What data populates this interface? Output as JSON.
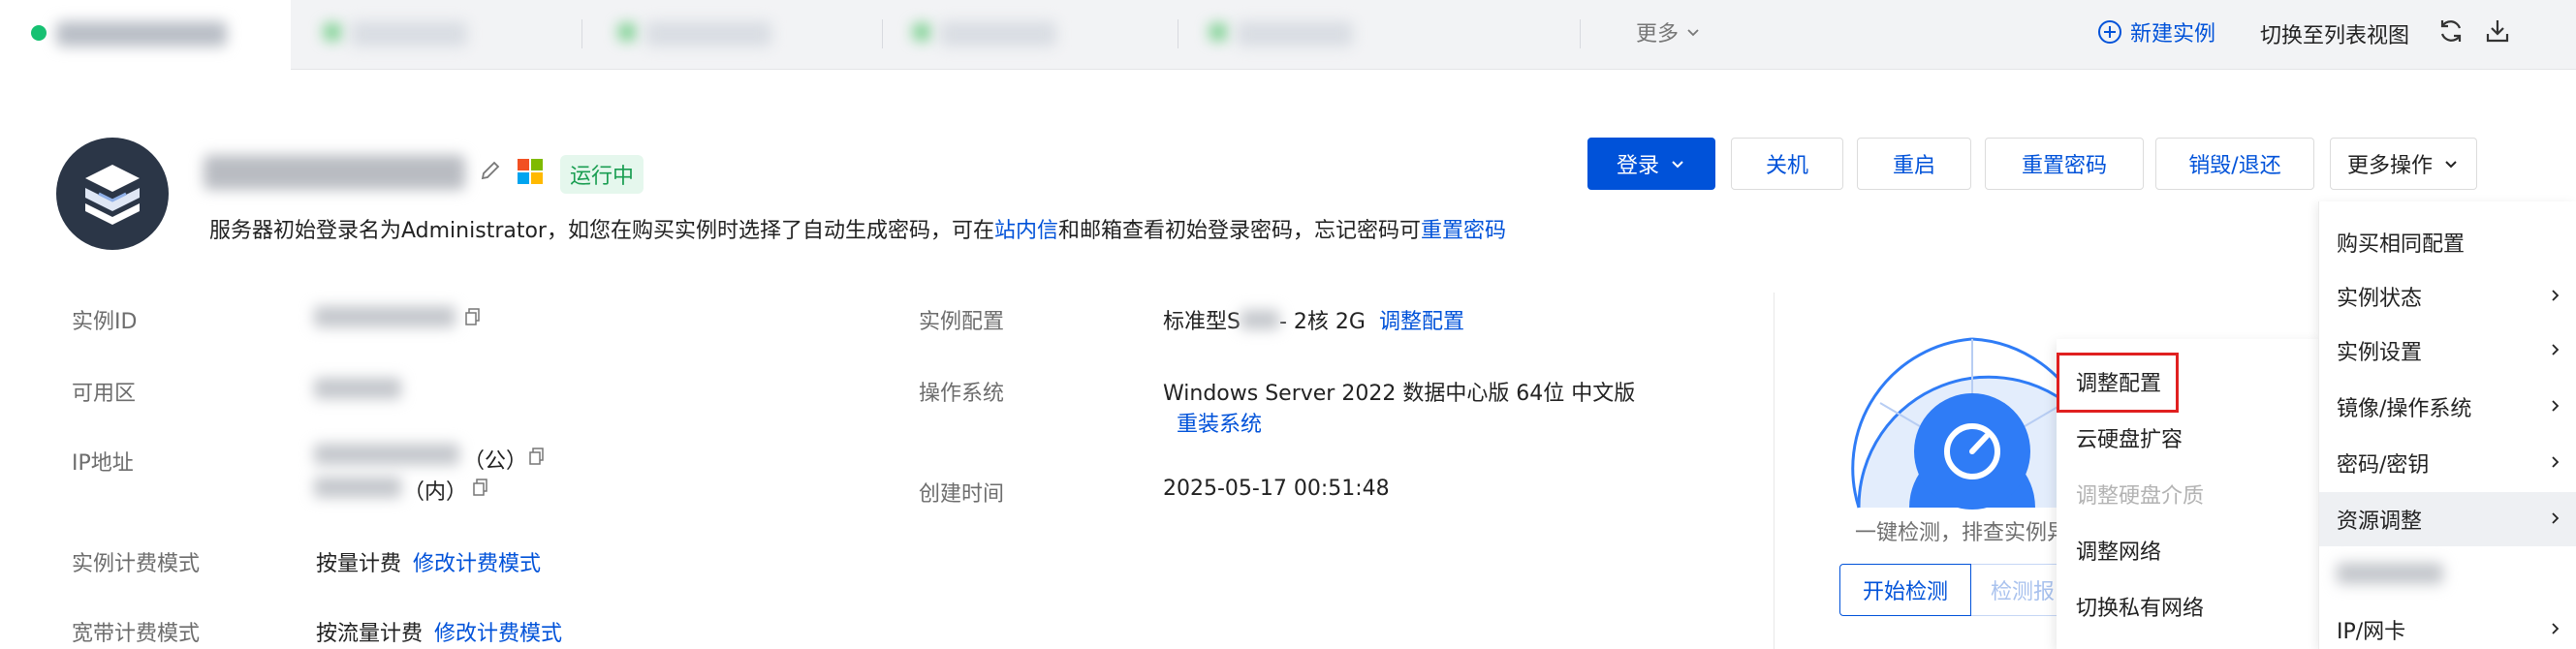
{
  "tabbar": {
    "more_label": "更多",
    "new_instance_label": "新建实例",
    "switch_list_label": "切换至列表视图"
  },
  "instance": {
    "status": "运行中",
    "login_tip_prefix": "服务器初始登录名为Administrator，如您在购买实例时选择了自动生成密码，可在",
    "login_tip_link1": "站内信",
    "login_tip_middle": "和邮箱查看初始登录密码，忘记密码可",
    "login_tip_link2": "重置密码"
  },
  "actions": {
    "login": "登录",
    "shutdown": "关机",
    "restart": "重启",
    "reset_password": "重置密码",
    "destroy": "销毁/退还",
    "more_ops": "更多操作"
  },
  "info": {
    "instance_id_label": "实例ID",
    "zone_label": "可用区",
    "ip_label": "IP地址",
    "ip_public_suffix": "（公）",
    "ip_private_suffix": "（内）",
    "billing_label": "实例计费模式",
    "billing_value": "按量计费",
    "billing_link": "修改计费模式",
    "bandwidth_label": "宽带计费模式",
    "bandwidth_value": "按流量计费",
    "bandwidth_link": "修改计费模式",
    "config_label": "实例配置",
    "config_value_prefix": "标准型S",
    "config_value_suffix": "- 2核 2G",
    "config_link": "调整配置",
    "os_label": "操作系统",
    "os_value": "Windows Server 2022 数据中心版 64位 中文版",
    "os_link": "重装系统",
    "created_label": "创建时间",
    "created_value": "2025-05-17 00:51:48"
  },
  "gauge": {
    "desc": "一键检测，排查实例异",
    "start_btn": "开始检测",
    "report_btn": "检测报"
  },
  "more_menu": {
    "items": [
      {
        "label": "购买相同配置",
        "has_sub": false
      },
      {
        "label": "实例状态",
        "has_sub": true
      },
      {
        "label": "实例设置",
        "has_sub": true
      },
      {
        "label": "镜像/操作系统",
        "has_sub": true
      },
      {
        "label": "密码/密钥",
        "has_sub": true
      },
      {
        "label": "资源调整",
        "has_sub": true,
        "active": true
      },
      {
        "label": "",
        "has_sub": false
      },
      {
        "label": "IP/网卡",
        "has_sub": true
      }
    ]
  },
  "resource_submenu": {
    "items": [
      {
        "label": "调整配置",
        "highlighted": true
      },
      {
        "label": "云硬盘扩容"
      },
      {
        "label": "调整硬盘介质",
        "disabled": true
      },
      {
        "label": "调整网络"
      },
      {
        "label": "切换私有网络"
      }
    ]
  },
  "colors": {
    "primary": "#0052d9",
    "success": "#1a9e52",
    "highlight_border": "#e02020",
    "gauge_blue": "#2f7cf6"
  }
}
